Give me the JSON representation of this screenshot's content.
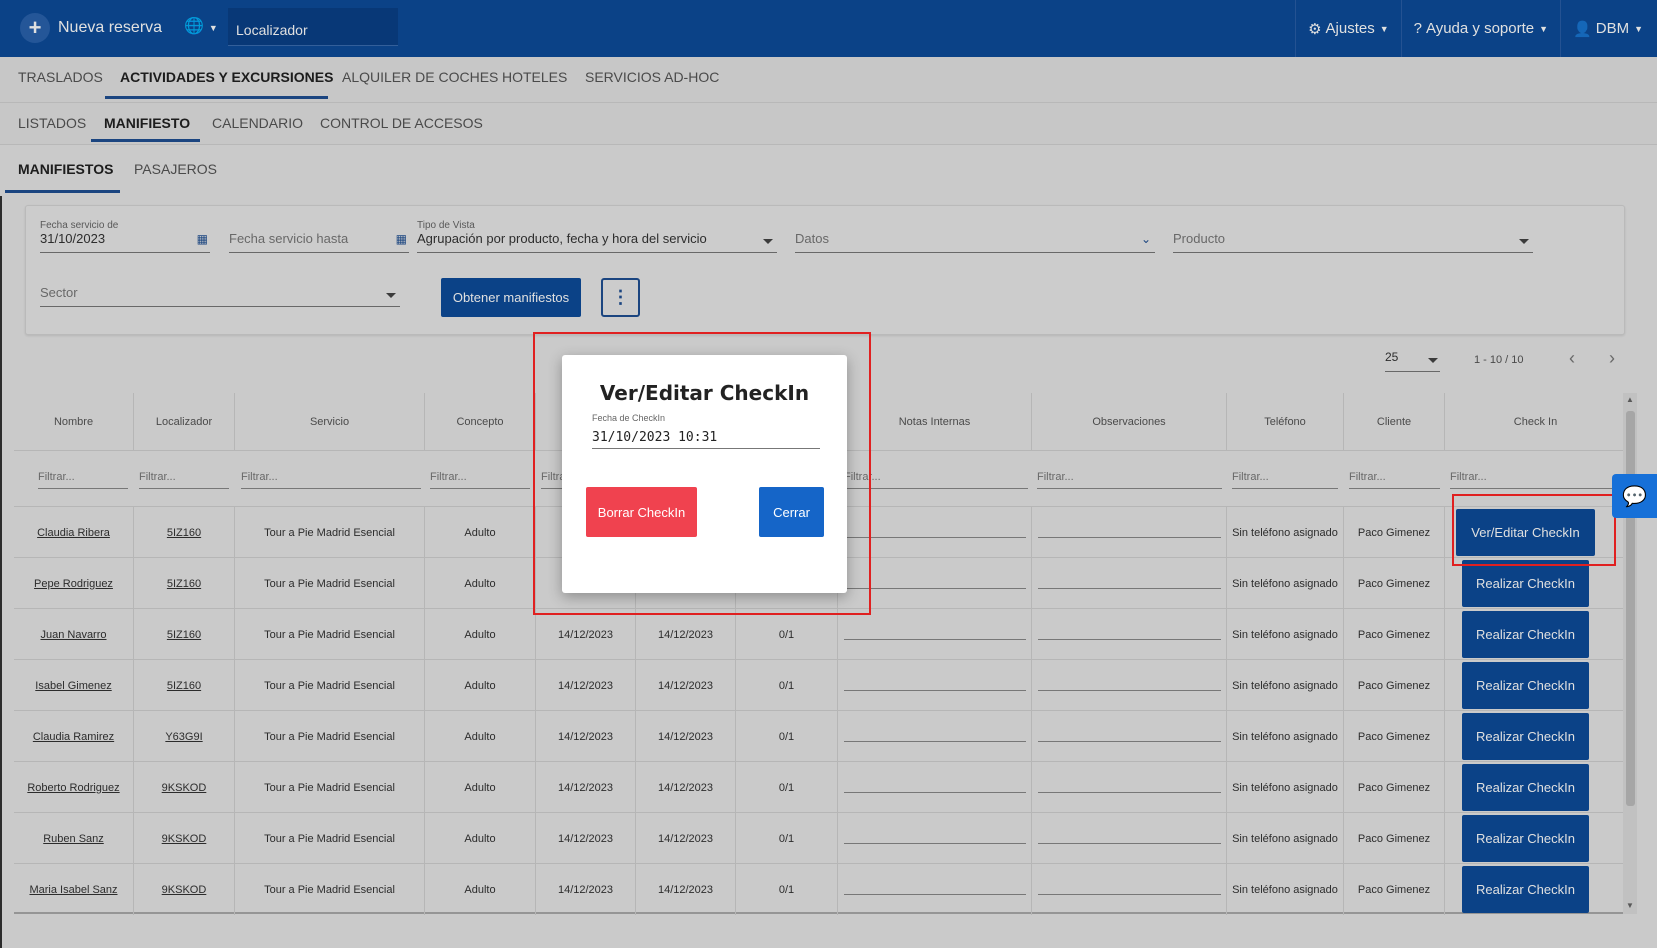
{
  "topbar": {
    "new_label": "Nueva reserva",
    "locator_placeholder": "Localizador",
    "settings": "Ajustes",
    "help": "Ayuda y soporte",
    "user": "DBM"
  },
  "tabs_main": [
    "TRASLADOS",
    "ACTIVIDADES Y EXCURSIONES",
    "ALQUILER DE COCHES",
    "HOTELES",
    "SERVICIOS AD-HOC"
  ],
  "tabs_sub": [
    "LISTADOS",
    "MANIFIESTO",
    "CALENDARIO",
    "CONTROL DE ACCESOS"
  ],
  "tabs_third": [
    "MANIFIESTOS",
    "PASAJEROS"
  ],
  "filters": {
    "date_from_label": "Fecha servicio de",
    "date_from_value": "31/10/2023",
    "date_to_placeholder": "Fecha servicio hasta",
    "view_type_label": "Tipo de Vista",
    "view_type_value": "Agrupación por producto, fecha y hora del servicio",
    "data_placeholder": "Datos",
    "product_placeholder": "Producto",
    "sector_placeholder": "Sector",
    "get_button": "Obtener manifiestos"
  },
  "pagination": {
    "per_page": "25",
    "range": "1 - 10 / 10"
  },
  "table": {
    "headers": [
      "Nombre",
      "Localizador",
      "Servicio",
      "Concepto",
      "Fe",
      "",
      "",
      "Notas Internas",
      "Observaciones",
      "Teléfono",
      "Cliente",
      "Check In"
    ],
    "filter_placeholder": "Filtrar...",
    "rows": [
      {
        "name": "Claudia Ribera",
        "loc": "5IZ160",
        "service": "Tour a Pie Madrid Esencial",
        "concept": "Adulto",
        "date1": "",
        "date2": "",
        "pax": "",
        "phone": "Sin teléfono asignado",
        "client": "Paco Gimenez",
        "action": "Ver/Editar CheckIn"
      },
      {
        "name": "Pepe Rodriguez",
        "loc": "5IZ160",
        "service": "Tour a Pie Madrid Esencial",
        "concept": "Adulto",
        "date1": "",
        "date2": "",
        "pax": "",
        "phone": "Sin teléfono asignado",
        "client": "Paco Gimenez",
        "action": "Realizar CheckIn"
      },
      {
        "name": "Juan Navarro",
        "loc": "5IZ160",
        "service": "Tour a Pie Madrid Esencial",
        "concept": "Adulto",
        "date1": "14/12/2023",
        "date2": "14/12/2023",
        "pax": "0/1",
        "phone": "Sin teléfono asignado",
        "client": "Paco Gimenez",
        "action": "Realizar CheckIn"
      },
      {
        "name": "Isabel Gimenez",
        "loc": "5IZ160",
        "service": "Tour a Pie Madrid Esencial",
        "concept": "Adulto",
        "date1": "14/12/2023",
        "date2": "14/12/2023",
        "pax": "0/1",
        "phone": "Sin teléfono asignado",
        "client": "Paco Gimenez",
        "action": "Realizar CheckIn"
      },
      {
        "name": "Claudia Ramirez",
        "loc": "Y63G9I",
        "service": "Tour a Pie Madrid Esencial",
        "concept": "Adulto",
        "date1": "14/12/2023",
        "date2": "14/12/2023",
        "pax": "0/1",
        "phone": "Sin teléfono asignado",
        "client": "Paco Gimenez",
        "action": "Realizar CheckIn"
      },
      {
        "name": "Roberto Rodriguez",
        "loc": "9KSKOD",
        "service": "Tour a Pie Madrid Esencial",
        "concept": "Adulto",
        "date1": "14/12/2023",
        "date2": "14/12/2023",
        "pax": "0/1",
        "phone": "Sin teléfono asignado",
        "client": "Paco Gimenez",
        "action": "Realizar CheckIn"
      },
      {
        "name": "Ruben Sanz",
        "loc": "9KSKOD",
        "service": "Tour a Pie Madrid Esencial",
        "concept": "Adulto",
        "date1": "14/12/2023",
        "date2": "14/12/2023",
        "pax": "0/1",
        "phone": "Sin teléfono asignado",
        "client": "Paco Gimenez",
        "action": "Realizar CheckIn"
      },
      {
        "name": "Maria Isabel Sanz",
        "loc": "9KSKOD",
        "service": "Tour a Pie Madrid Esencial",
        "concept": "Adulto",
        "date1": "14/12/2023",
        "date2": "14/12/2023",
        "pax": "0/1",
        "phone": "Sin teléfono asignado",
        "client": "Paco Gimenez",
        "action": "Realizar CheckIn"
      }
    ]
  },
  "modal": {
    "title": "Ver/Editar CheckIn",
    "field_label": "Fecha de CheckIn",
    "field_value": "31/10/2023 10:31",
    "delete_button": "Borrar CheckIn",
    "close_button": "Cerrar"
  },
  "colors": {
    "brand": "#0d4c9a",
    "danger": "#f0424f",
    "highlight": "#e02020"
  }
}
